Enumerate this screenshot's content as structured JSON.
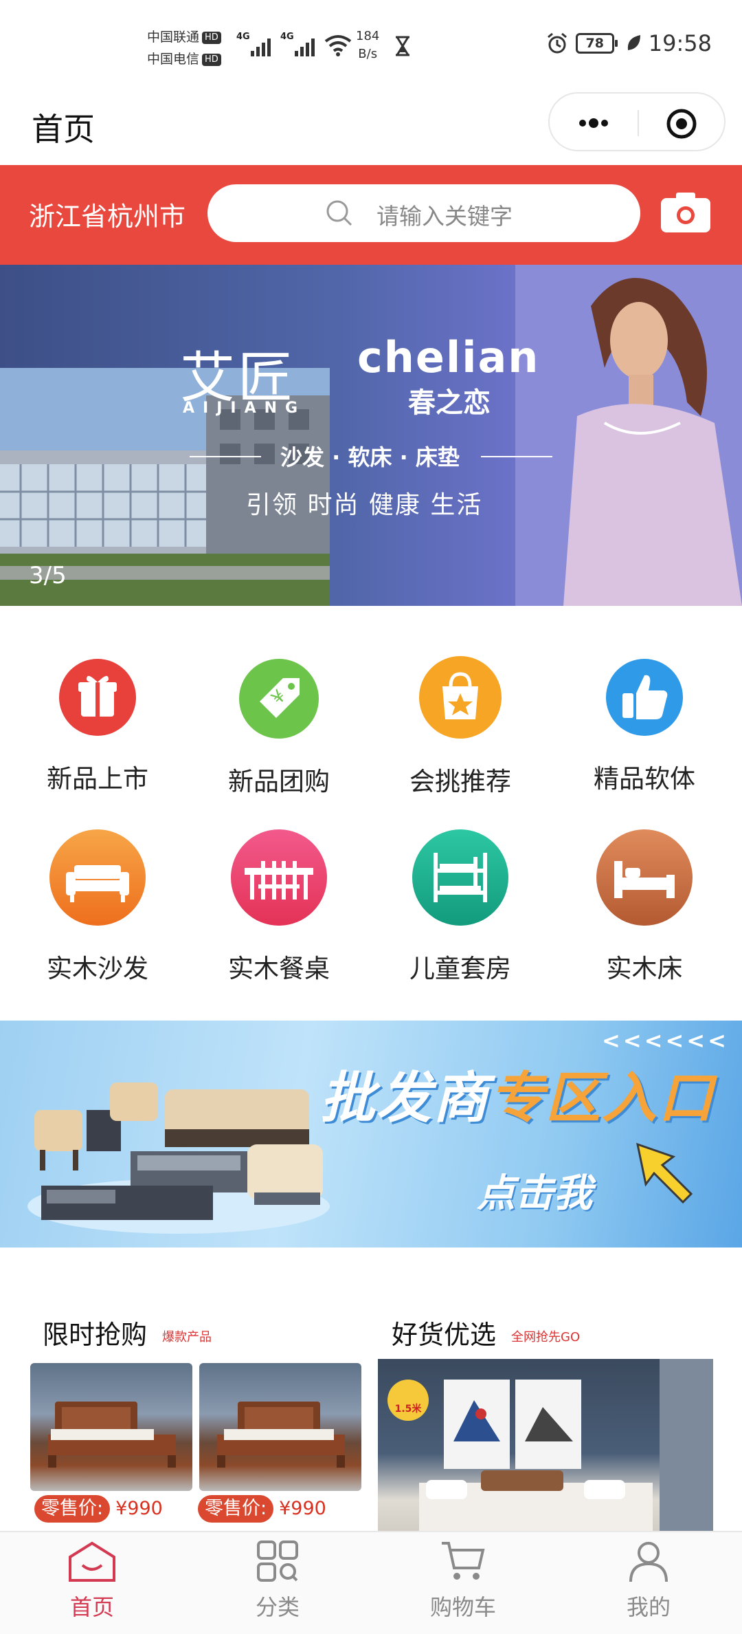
{
  "status_bar": {
    "carrier_1": "中国联通",
    "carrier_2": "中国电信",
    "hd": "HD",
    "network_1": "4G",
    "network_2": "4G",
    "net_speed_value": "184",
    "net_speed_unit": "B/s",
    "battery": "78",
    "time": "19:58"
  },
  "nav": {
    "title": "首页"
  },
  "header": {
    "location": "浙江省杭州市",
    "search_placeholder": "请输入关键字"
  },
  "banner": {
    "brand_cn": "艾匠",
    "brand_en": "AIJIANG",
    "brand_2_en": "chelian",
    "brand_2_cn": "春之恋",
    "products": "沙发 · 软床 · 床垫",
    "slogan": "引领 时尚 健康 生活",
    "counter": "3/5"
  },
  "categories": [
    {
      "label": "新品上市",
      "icon": "gift-icon",
      "color": "#e8413c"
    },
    {
      "label": "新品团购",
      "icon": "price-tag-icon",
      "color": "#6dc44a"
    },
    {
      "label": "会挑推荐",
      "icon": "shopping-bag-star-icon",
      "color": "#f7a524"
    },
    {
      "label": "精品软体",
      "icon": "thumbs-up-icon",
      "color": "#2f9be8"
    },
    {
      "label": "实木沙发",
      "icon": "sofa-icon",
      "color": "#f0822a"
    },
    {
      "label": "实木餐桌",
      "icon": "dining-table-icon",
      "color": "#ea3f6e"
    },
    {
      "label": "儿童套房",
      "icon": "bunk-bed-icon",
      "color": "#1fb592"
    },
    {
      "label": "实木床",
      "icon": "bed-icon",
      "color": "#c76a3e"
    }
  ],
  "wholesale": {
    "title_part_1": "批发商",
    "title_part_2": "专区入口",
    "cta": "点击我",
    "arrows": "<<<<<<"
  },
  "flash_sale": {
    "title": "限时抢购",
    "subtitle": "爆款产品",
    "items": [
      {
        "price_label": "零售价:",
        "price": "¥990"
      },
      {
        "price_label": "零售价:",
        "price": "¥990"
      }
    ]
  },
  "good_picks": {
    "title": "好货优选",
    "subtitle": "全网抢先GO",
    "badge": "1.5米"
  },
  "tab_bar": {
    "tabs": [
      {
        "label": "首页",
        "icon": "home-icon",
        "active": true
      },
      {
        "label": "分类",
        "icon": "category-icon",
        "active": false
      },
      {
        "label": "购物车",
        "icon": "cart-icon",
        "active": false
      },
      {
        "label": "我的",
        "icon": "user-icon",
        "active": false
      }
    ]
  },
  "colors": {
    "brand_red": "#e8483e",
    "tab_active": "#d33a52",
    "tab_inactive": "#8a8a8a"
  }
}
